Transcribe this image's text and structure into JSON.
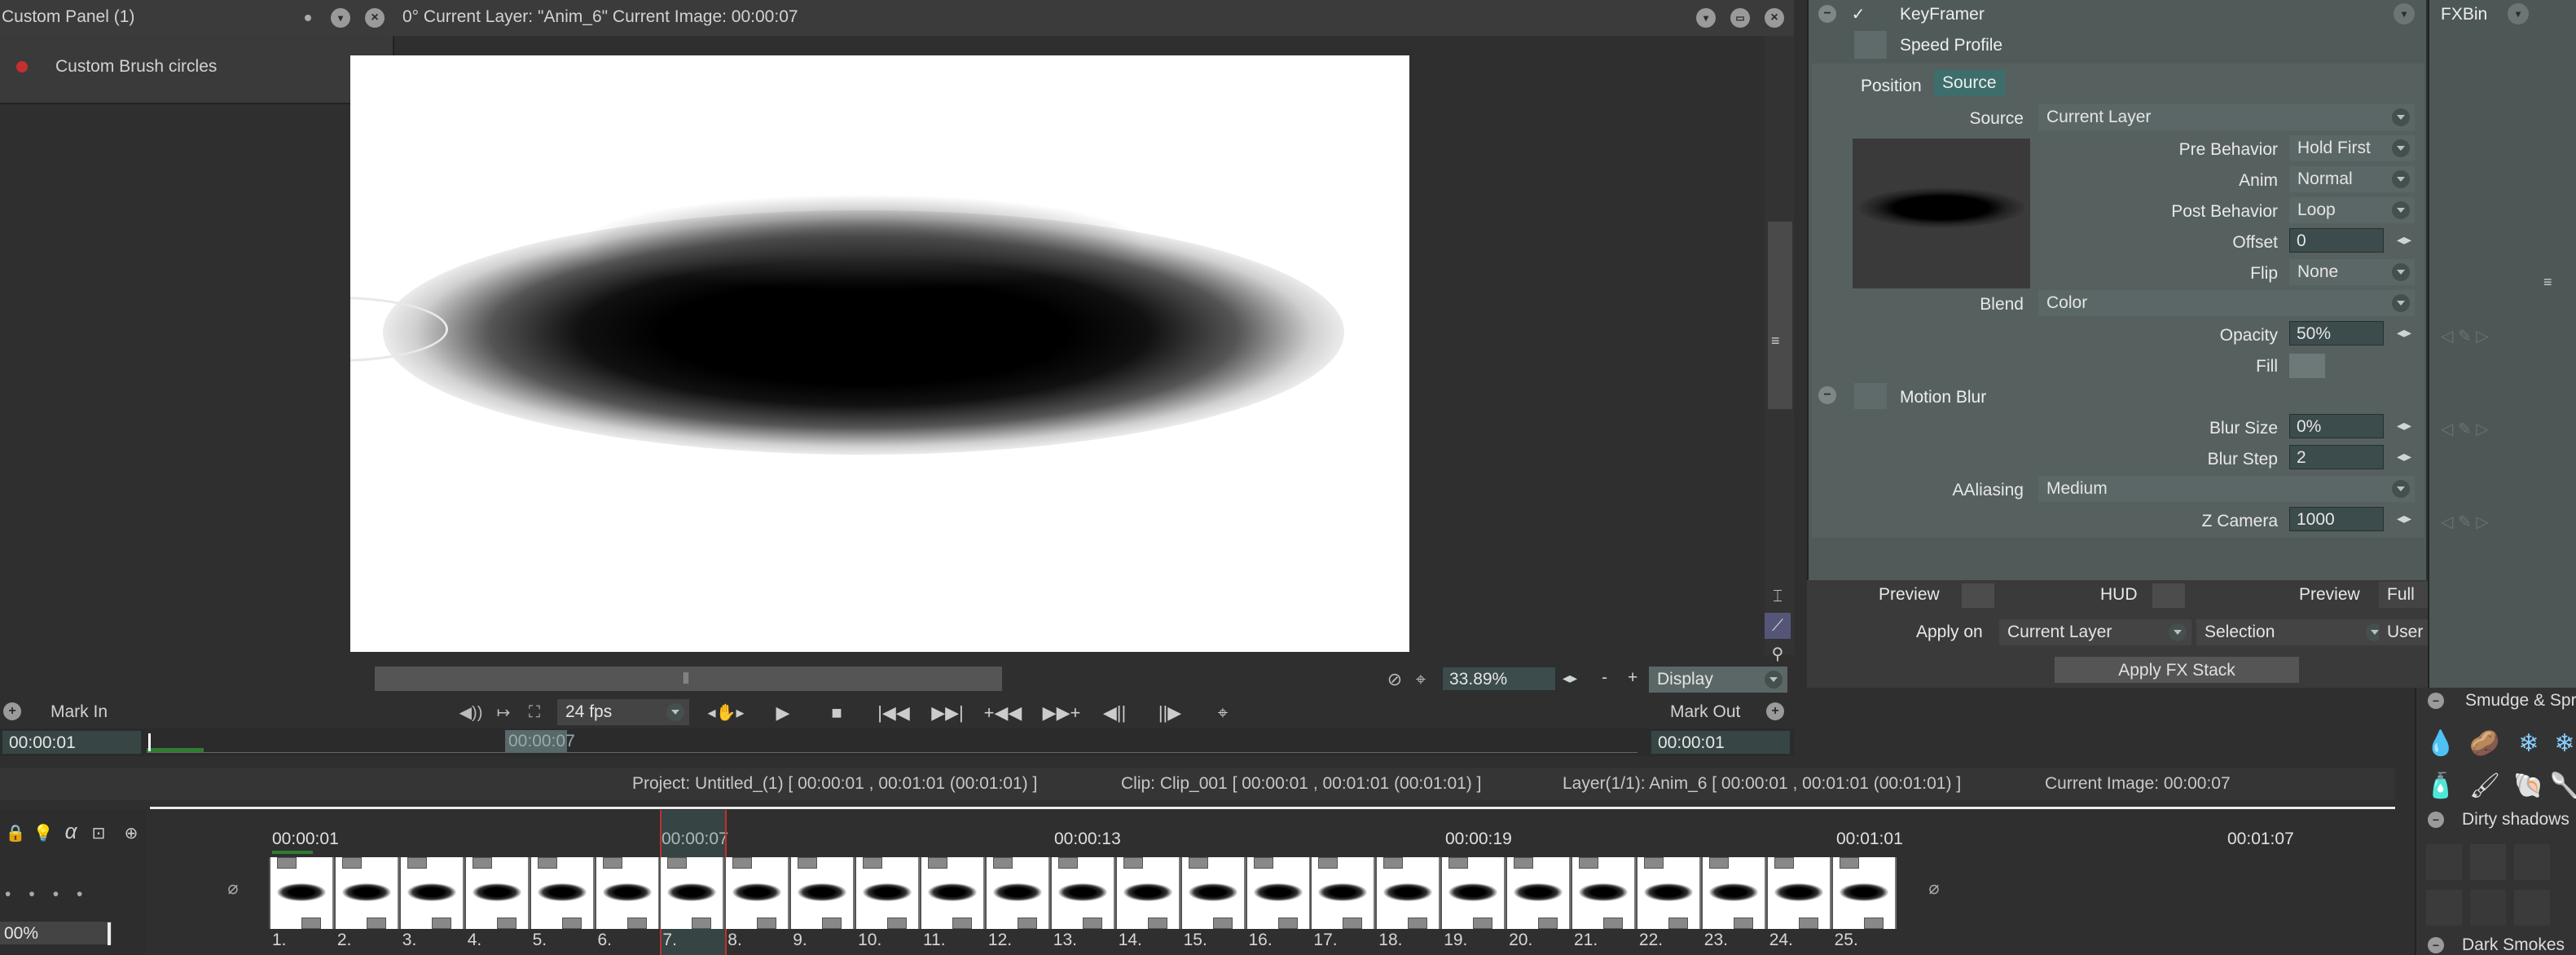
{
  "left_panel": {
    "title": "Custom Panel (1)",
    "item": "Custom Brush circles"
  },
  "viewer": {
    "header": "0°  Current Layer: \"Anim_6\"  Current Image: 00:00:07",
    "zoom": "33.89%",
    "display": "Display",
    "fps": "24 fps",
    "mark_in": "Mark In",
    "mark_out": "Mark Out",
    "mark_in_time": "00:00:01",
    "mark_out_time": "00:00:01",
    "scrub_time": "00:00:07"
  },
  "status": {
    "project": "Project: Untitled_(1) [ 00:00:01 , 00:01:01  (00:01:01) ]",
    "clip": "Clip: Clip_001 [ 00:00:01 , 00:01:01  (00:01:01) ]",
    "layer": "Layer(1/1): Anim_6 [ 00:00:01 , 00:01:01  (00:01:01) ]",
    "current": "Current Image: 00:00:07"
  },
  "timeline": {
    "timecodes": [
      "00:00:01",
      "00:00:07",
      "00:00:13",
      "00:00:19",
      "00:01:01",
      "00:01:07"
    ],
    "frames": [
      "1.",
      "2.",
      "3.",
      "4.",
      "5.",
      "6.",
      "7.",
      "8.",
      "9.",
      "10.",
      "11.",
      "12.",
      "13.",
      "14.",
      "15.",
      "16.",
      "17.",
      "18.",
      "19.",
      "20.",
      "21.",
      "22.",
      "23.",
      "24.",
      "25."
    ],
    "opacity": "00%"
  },
  "fx": {
    "keyframer": "KeyFramer",
    "speed_profile": "Speed Profile",
    "tab_position": "Position",
    "tab_source": "Source",
    "source_label": "Source",
    "source_value": "Current Layer",
    "pre_label": "Pre Behavior",
    "pre_value": "Hold First",
    "anim_label": "Anim",
    "anim_value": "Normal",
    "post_label": "Post Behavior",
    "post_value": "Loop",
    "offset_label": "Offset",
    "offset_value": "0",
    "flip_label": "Flip",
    "flip_value": "None",
    "blend_label": "Blend",
    "blend_value": "Color",
    "opacity_label": "Opacity",
    "opacity_value": "50%",
    "fill_label": "Fill",
    "motion_blur": "Motion Blur",
    "blur_size_label": "Blur Size",
    "blur_size_value": "0%",
    "blur_step_label": "Blur Step",
    "blur_step_value": "2",
    "aaliasing_label": "AAliasing",
    "aaliasing_value": "Medium",
    "zcamera_label": "Z Camera",
    "zcamera_value": "1000",
    "preview_label": "Preview",
    "hud_label": "HUD",
    "preview2_label": "Preview",
    "preview2_value": "Full",
    "apply_on_label": "Apply on",
    "apply_on_value": "Current Layer",
    "selection_value": "Selection",
    "user_defined_value": "User defined",
    "apply_stack": "Apply FX Stack"
  },
  "fxbin": {
    "title": "FXBin"
  },
  "brush_bin": {
    "smudge": "Smudge & Spr",
    "dirty": "Dirty shadows",
    "dark": "Dark Smokes"
  }
}
